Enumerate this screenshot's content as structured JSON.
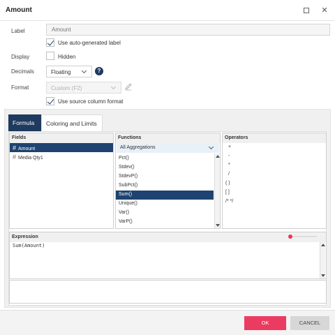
{
  "window": {
    "title": "Amount",
    "maximize_icon": "maximize-icon",
    "close_icon": "close-icon",
    "close_glyph": "✕"
  },
  "form": {
    "label": {
      "caption": "Label",
      "placeholder": "Amount",
      "value": ""
    },
    "auto_label": {
      "checked": true,
      "text": "Use auto-generated label"
    },
    "display": {
      "caption": "Display",
      "hidden_checked": false,
      "hidden_text": "Hidden"
    },
    "decimals": {
      "caption": "Decimals",
      "value": "Floating",
      "help": "?"
    },
    "format": {
      "caption": "Format",
      "value": "Custom (F2)",
      "edit_icon": "pencil-icon"
    },
    "source_format": {
      "checked": true,
      "text": "Use source column format"
    }
  },
  "tabs": [
    {
      "label": "Formula",
      "active": true
    },
    {
      "label": "Coloring and Limits",
      "active": false
    }
  ],
  "fields": {
    "title": "Fields",
    "items": [
      {
        "icon": "#",
        "label": "Amount",
        "selected": true
      },
      {
        "icon": "#",
        "label": "Media Qty1",
        "selected": false
      }
    ]
  },
  "functions": {
    "title": "Functions",
    "filter": "All Aggregations",
    "items": [
      {
        "label": "Pct()",
        "selected": false
      },
      {
        "label": "Stdev()",
        "selected": false
      },
      {
        "label": "StdevP()",
        "selected": false
      },
      {
        "label": "SubPct()",
        "selected": false
      },
      {
        "label": "Sum()",
        "selected": true
      },
      {
        "label": "Unique()",
        "selected": false
      },
      {
        "label": "Var()",
        "selected": false
      },
      {
        "label": "VarP()",
        "selected": false
      }
    ]
  },
  "operators": {
    "title": "Operators",
    "items": [
      "+",
      "-",
      "*",
      "/",
      "( )",
      "[ ]",
      "/* */"
    ]
  },
  "expression": {
    "title": "Expression",
    "value": "Sum(Amount)"
  },
  "footer": {
    "ok": "OK",
    "cancel": "CANCEL"
  },
  "colors": {
    "accent": "#1e3a5f",
    "primary_button": "#ec3b61"
  }
}
